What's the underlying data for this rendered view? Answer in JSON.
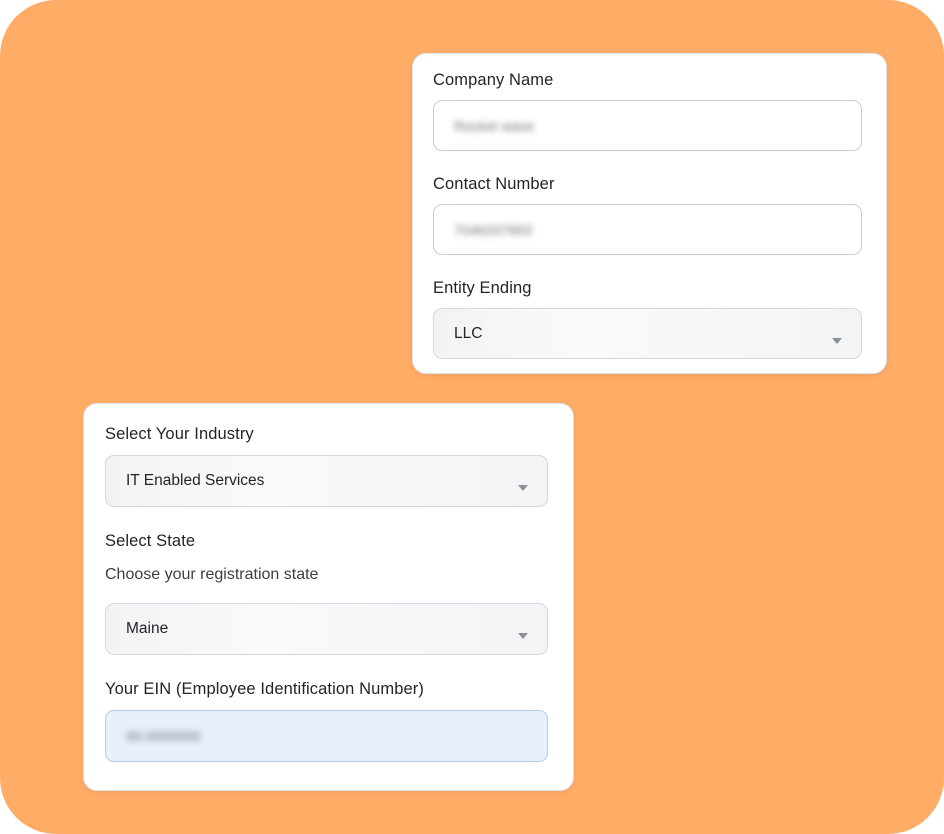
{
  "company_card": {
    "company_name": {
      "label": "Company Name",
      "value": "Rocket wave"
    },
    "contact_number": {
      "label": "Contact Number",
      "value": "7046337893"
    },
    "entity_ending": {
      "label": "Entity Ending",
      "value": "LLC"
    }
  },
  "registration_card": {
    "industry": {
      "label": "Select Your Industry",
      "value": "IT Enabled Services"
    },
    "state": {
      "label": "Select State",
      "helper": "Choose your registration state",
      "value": "Maine"
    },
    "ein": {
      "label": "Your EIN (Employee Identification Number)",
      "value": "00-0000000"
    }
  },
  "colors": {
    "background": "#ffac67",
    "card": "#ffffff",
    "focused_field": "#e8f0fd"
  }
}
